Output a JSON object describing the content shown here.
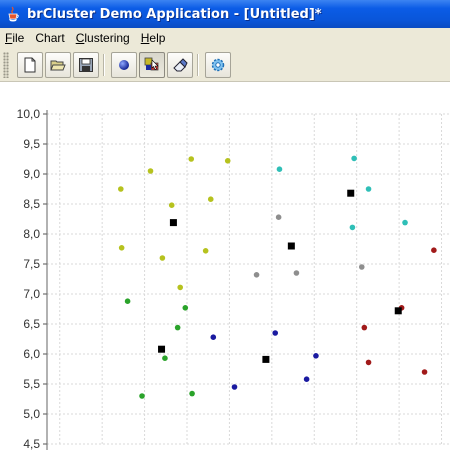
{
  "window": {
    "title": "brCluster Demo Application - [Untitled]*"
  },
  "menubar": {
    "items": [
      {
        "mnemonic": "F",
        "rest": "ile"
      },
      {
        "mnemonic": "",
        "rest": "Chart"
      },
      {
        "mnemonic": "C",
        "rest": "lustering"
      },
      {
        "mnemonic": "H",
        "rest": "elp"
      }
    ]
  },
  "toolbar": {
    "buttons": [
      {
        "icon": "new-document-icon"
      },
      {
        "icon": "open-folder-icon"
      },
      {
        "icon": "save-disk-icon"
      },
      {
        "icon": "add-point-icon"
      },
      {
        "icon": "select-points-icon",
        "pressed": true
      },
      {
        "icon": "eraser-icon"
      },
      {
        "icon": "cluster-gear-icon"
      }
    ]
  },
  "colors": {
    "titlebar": "#0a56da",
    "chrome": "#ece9d8",
    "gridline": "#d9d9d9",
    "cluster_yellow": "#b6c21e",
    "cluster_green": "#2aa32a",
    "cluster_cyan": "#2fbfb7",
    "cluster_gray": "#8e8e8e",
    "cluster_navy": "#1a1aa0",
    "cluster_red": "#a11a1a",
    "centroid": "#000000"
  },
  "chart_data": {
    "type": "scatter",
    "title": "",
    "xlabel": "",
    "ylabel": "",
    "ylim": [
      4.5,
      10.0
    ],
    "yticks": [
      "10,0",
      "9,5",
      "9,0",
      "8,5",
      "8,0",
      "7,5",
      "7,0",
      "6,5",
      "6,0",
      "5,5",
      "5,0",
      "4,5"
    ],
    "grid": true,
    "series": [
      {
        "color": "#b6c21e",
        "marker": "circle",
        "points": [
          [
            1.72,
            8.75
          ],
          [
            2.07,
            9.05
          ],
          [
            2.55,
            9.25
          ],
          [
            2.98,
            9.22
          ],
          [
            2.32,
            8.48
          ],
          [
            2.78,
            8.58
          ],
          [
            1.73,
            7.77
          ],
          [
            2.21,
            7.6
          ],
          [
            2.72,
            7.72
          ],
          [
            2.42,
            7.11
          ]
        ]
      },
      {
        "color": "#2aa32a",
        "marker": "circle",
        "points": [
          [
            1.8,
            6.88
          ],
          [
            2.48,
            6.77
          ],
          [
            2.39,
            6.44
          ],
          [
            2.24,
            5.93
          ],
          [
            1.97,
            5.3
          ],
          [
            2.56,
            5.34
          ]
        ]
      },
      {
        "color": "#2fbfb7",
        "marker": "circle",
        "points": [
          [
            3.59,
            9.08
          ],
          [
            4.47,
            9.26
          ],
          [
            4.64,
            8.75
          ],
          [
            5.07,
            8.19
          ],
          [
            4.45,
            8.11
          ]
        ]
      },
      {
        "color": "#8e8e8e",
        "marker": "circle",
        "points": [
          [
            3.58,
            8.28
          ],
          [
            3.32,
            7.32
          ],
          [
            3.79,
            7.35
          ],
          [
            4.56,
            7.45
          ]
        ]
      },
      {
        "color": "#1a1aa0",
        "marker": "circle",
        "points": [
          [
            2.81,
            6.28
          ],
          [
            3.54,
            6.35
          ],
          [
            4.02,
            5.97
          ],
          [
            3.91,
            5.58
          ],
          [
            3.06,
            5.45
          ]
        ]
      },
      {
        "color": "#a11a1a",
        "marker": "circle",
        "points": [
          [
            5.41,
            7.73
          ],
          [
            5.03,
            6.77
          ],
          [
            4.59,
            6.44
          ],
          [
            4.64,
            5.86
          ],
          [
            5.3,
            5.7
          ]
        ]
      },
      {
        "color": "#000000",
        "marker": "square",
        "points": [
          [
            2.34,
            8.19
          ],
          [
            4.43,
            8.68
          ],
          [
            3.73,
            7.8
          ],
          [
            4.99,
            6.72
          ],
          [
            2.2,
            6.08
          ],
          [
            3.43,
            5.91
          ]
        ]
      }
    ]
  }
}
